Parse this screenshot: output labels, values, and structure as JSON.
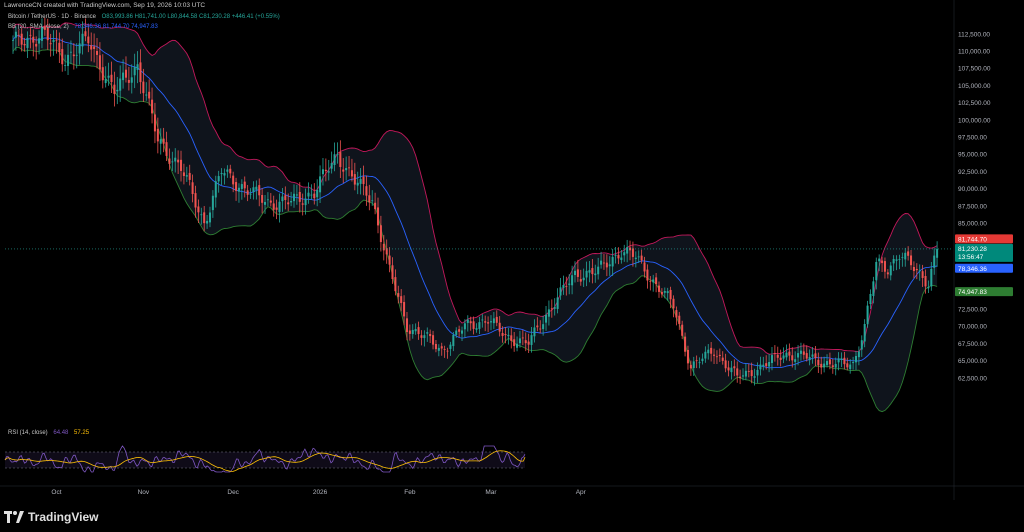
{
  "header": {
    "attribution": "LawrenceCN created with TradingView.com, Sep 19, 2026 10:03 UTC"
  },
  "legend": {
    "symbol": "Bitcoin / TetherUS · 1D · Binance",
    "ohlc": "O83,993.86 H81,741.00 L80,844.58 C81,230.28 +446.41 (+0.55%)",
    "bb_label": "BB (20, SMA, close, 2)",
    "bb_values": "78,346.36  81,744.70  74,947.83",
    "rsi_label": "RSI (14, close)",
    "rsi_value": "64.48",
    "rsi_ma": "57.25"
  },
  "price_tags": {
    "upper": "81,744.70",
    "close": "81,230.28",
    "countdown": "13:56:47",
    "basis": "78,346.36",
    "lower": "74,947.83"
  },
  "brand": {
    "name": "TradingView"
  },
  "colors": {
    "background": "#000000",
    "up": "#26a69a",
    "down": "#ef5350",
    "bb_upper": "#c2185b",
    "bb_lower": "#2e7d32",
    "bb_basis": "#2962ff",
    "rsi": "#7e57c2",
    "rsi_ma": "#ffc107",
    "axis_text": "#b2b5be"
  },
  "chart_data": [
    {
      "type": "candlestick",
      "title": "Bitcoin / TetherUS · 1D · Binance",
      "x_tick_labels": [
        "Oct",
        "Nov",
        "Dec",
        "2026",
        "Feb",
        "Mar",
        "Apr"
      ],
      "y_tick_labels": [
        "112,500.00",
        "110,000.00",
        "107,500.00",
        "105,000.00",
        "102,500.00",
        "100,000.00",
        "97,500.00",
        "95,000.00",
        "92,500.00",
        "90,000.00",
        "87,500.00",
        "85,000.00",
        "72,500.00",
        "70,000.00",
        "67,500.00",
        "65,000.00",
        "62,500.00"
      ],
      "ylim": [
        60000,
        114500
      ],
      "anchors": [
        {
          "day": 0,
          "close": 111000
        },
        {
          "day": 10,
          "close": 112500
        },
        {
          "day": 18,
          "close": 109000
        },
        {
          "day": 26,
          "close": 111500
        },
        {
          "day": 35,
          "close": 104000
        },
        {
          "day": 43,
          "close": 108000
        },
        {
          "day": 50,
          "close": 97000
        },
        {
          "day": 58,
          "close": 93000
        },
        {
          "day": 66,
          "close": 85000
        },
        {
          "day": 72,
          "close": 92500
        },
        {
          "day": 80,
          "close": 90000
        },
        {
          "day": 88,
          "close": 88000
        },
        {
          "day": 96,
          "close": 88000
        },
        {
          "day": 104,
          "close": 89500
        },
        {
          "day": 112,
          "close": 95000
        },
        {
          "day": 118,
          "close": 91000
        },
        {
          "day": 124,
          "close": 88500
        },
        {
          "day": 130,
          "close": 78000
        },
        {
          "day": 136,
          "close": 70000
        },
        {
          "day": 142,
          "close": 68500
        },
        {
          "day": 148,
          "close": 66500
        },
        {
          "day": 156,
          "close": 70000
        },
        {
          "day": 164,
          "close": 71000
        },
        {
          "day": 170,
          "close": 68500
        },
        {
          "day": 178,
          "close": 67500
        },
        {
          "day": 186,
          "close": 73000
        },
        {
          "day": 194,
          "close": 77500
        },
        {
          "day": 202,
          "close": 78000
        },
        {
          "day": 210,
          "close": 81000
        },
        {
          "day": 215,
          "close": 80000
        },
        {
          "day": 222,
          "close": 76000
        },
        {
          "day": 228,
          "close": 73000
        },
        {
          "day": 234,
          "close": 64000
        },
        {
          "day": 242,
          "close": 66500
        },
        {
          "day": 250,
          "close": 62500
        },
        {
          "day": 258,
          "close": 64000
        },
        {
          "day": 266,
          "close": 66000
        },
        {
          "day": 274,
          "close": 65500
        },
        {
          "day": 282,
          "close": 64500
        },
        {
          "day": 290,
          "close": 64500
        },
        {
          "day": 294,
          "close": 70000
        },
        {
          "day": 298,
          "close": 79000
        },
        {
          "day": 302,
          "close": 78500
        },
        {
          "day": 306,
          "close": 80500
        },
        {
          "day": 312,
          "close": 78000
        },
        {
          "day": 316,
          "close": 76500
        },
        {
          "day": 319,
          "close": 81230
        }
      ],
      "bollinger": {
        "length": 20,
        "basis": 78346.36,
        "upper": 81744.7,
        "lower": 74947.83
      },
      "last_close": 81230.28
    },
    {
      "type": "line",
      "title": "RSI (14, close)",
      "series": [
        {
          "name": "RSI",
          "last": 64.48
        },
        {
          "name": "MA",
          "last": 57.25
        }
      ],
      "ylim": [
        0,
        100
      ],
      "bands": [
        30,
        70
      ]
    }
  ]
}
